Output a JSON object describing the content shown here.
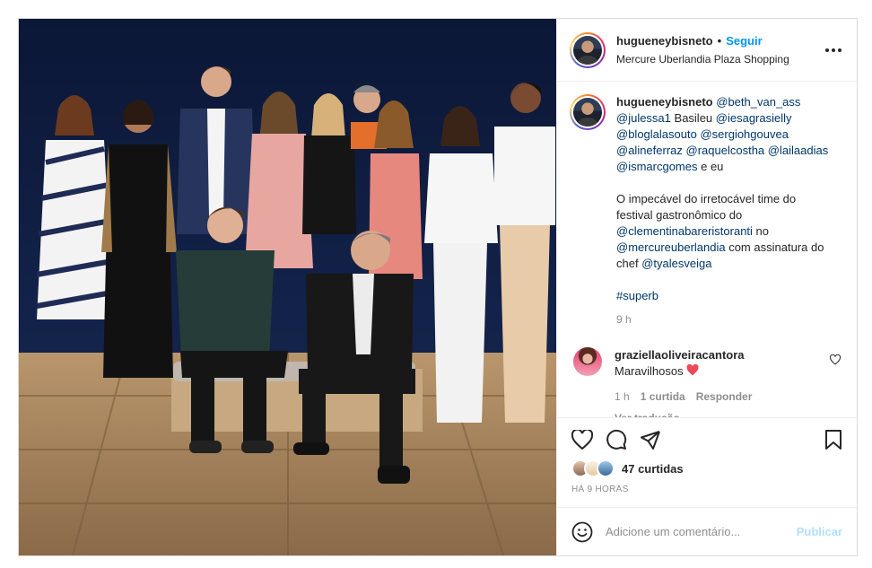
{
  "post": {
    "author": {
      "username": "hugueneybisneto",
      "follow_label": "Seguir",
      "dot": "•",
      "location": "Mercure Uberlandia Plaza Shopping"
    },
    "caption": {
      "username": "hugueneybisneto",
      "segments": [
        {
          "type": "mention",
          "text": "@beth_van_ass"
        },
        {
          "type": "text",
          "text": " "
        },
        {
          "type": "mention",
          "text": "@julessa1"
        },
        {
          "type": "text",
          "text": " Basileu "
        },
        {
          "type": "mention",
          "text": "@iesagrasielly"
        },
        {
          "type": "text",
          "text": " "
        },
        {
          "type": "mention",
          "text": "@bloglalasouto"
        },
        {
          "type": "text",
          "text": " "
        },
        {
          "type": "mention",
          "text": "@sergiohgouvea"
        },
        {
          "type": "text",
          "text": " "
        },
        {
          "type": "mention",
          "text": "@alineferraz"
        },
        {
          "type": "text",
          "text": " "
        },
        {
          "type": "mention",
          "text": "@raquelcostha"
        },
        {
          "type": "text",
          "text": " "
        },
        {
          "type": "mention",
          "text": "@lailaadias"
        },
        {
          "type": "text",
          "text": " "
        },
        {
          "type": "mention",
          "text": "@ismarcgomes"
        },
        {
          "type": "text",
          "text": " e eu"
        }
      ],
      "body_segments": [
        {
          "type": "text",
          "text": "O impecável do irretocável time do festival gastronômico do "
        },
        {
          "type": "mention",
          "text": "@clementinabareristoranti"
        },
        {
          "type": "text",
          "text": " no "
        },
        {
          "type": "mention",
          "text": "@mercureuberlandia"
        },
        {
          "type": "text",
          "text": " com assinatura do chef "
        },
        {
          "type": "mention",
          "text": "@tyalesveiga"
        }
      ],
      "hashtag": "#superb",
      "time": "9 h"
    },
    "comment": {
      "username": "graziellaoliveiracantora",
      "text": "Maravilhosos",
      "emoji": "❤️",
      "time": "1 h",
      "likes": "1 curtida",
      "reply": "Responder",
      "see_translation": "Ver tradução"
    },
    "actions": {
      "icons": [
        "heart-icon",
        "comment-icon",
        "share-icon",
        "bookmark-icon"
      ],
      "likes_count": "47 curtidas",
      "time_ago": "HÁ 9 HORAS"
    },
    "add_comment": {
      "placeholder": "Adicione um comentário...",
      "publish_label": "Publicar"
    },
    "colors": {
      "link": "#00376b",
      "follow": "#0095f6",
      "publish_disabled": "#b2dffc",
      "secondary_text": "#8e8e8e",
      "heart_red": "#ed4956"
    }
  }
}
